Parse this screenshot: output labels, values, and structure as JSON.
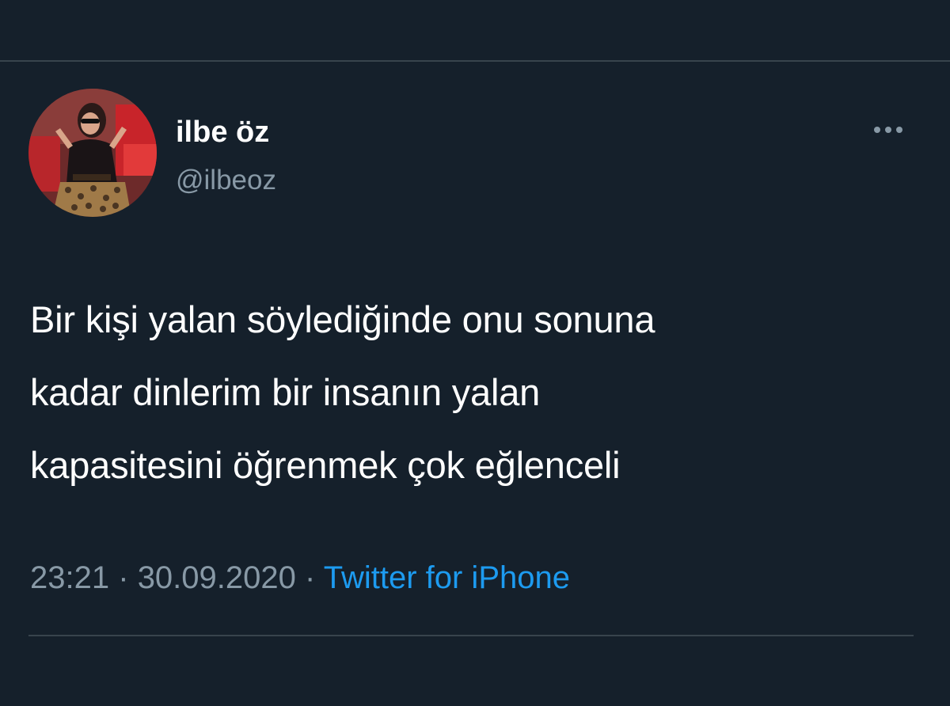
{
  "author": {
    "display_name": "ilbe öz",
    "handle": "@ilbeoz"
  },
  "tweet": {
    "lines": [
      "Bir kişi yalan söylediğinde onu sonuna",
      "kadar dinlerim bir insanın yalan",
      "kapasitesini öğrenmek çok eğlenceli"
    ]
  },
  "meta": {
    "time": "23:21",
    "separator": "·",
    "date": "30.09.2020",
    "source": "Twitter for iPhone"
  },
  "icons": {
    "more": "more-horizontal-icon"
  },
  "colors": {
    "background": "#15202b",
    "secondary_text": "#8899a6",
    "link": "#1d9bf0",
    "divider": "#38444d"
  }
}
